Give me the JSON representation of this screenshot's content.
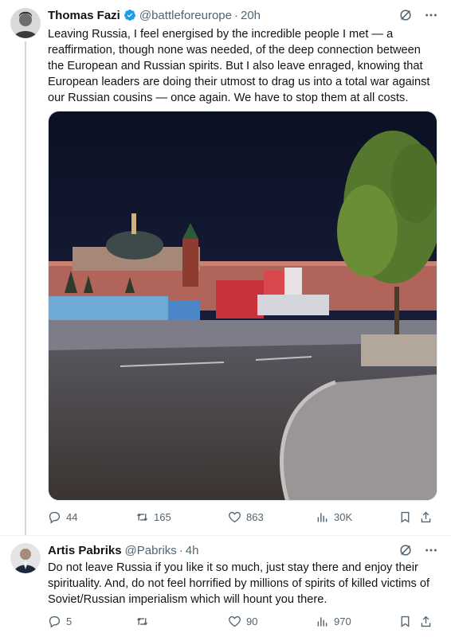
{
  "tweet1": {
    "author_name": "Thomas Fazi",
    "handle": "@battleforeurope",
    "separator": "·",
    "time": "20h",
    "verified_color": "#1d9bf0",
    "text": "Leaving Russia, I feel energised by the incredible people I met — a reaffirmation, though none was needed, of the deep connection between the European and Russian spirits. But I also leave enraged, knowing that European leaders are doing their utmost to drag us into a total war against our Russian cousins — once again. We have to stop them at all costs.",
    "image_alt_icons": [
      "kremlin-wall",
      "trees",
      "street-lamp"
    ],
    "replies": "44",
    "reposts": "165",
    "likes": "863",
    "views": "30K"
  },
  "tweet2": {
    "author_name": "Artis Pabriks",
    "handle": "@Pabriks",
    "separator": "·",
    "time": "4h",
    "text": "Do not leave Russia if you like it so much, just stay there and enjoy their spirituality. And, do not feel horrified by millions of spirits of killed victims of Soviet/Russian imperialism which will hount you there.",
    "replies": "5",
    "reposts": "",
    "likes": "90",
    "views": "970"
  },
  "colors": {
    "text_primary": "#0f1419",
    "text_secondary": "#536471",
    "accent": "#1d9bf0",
    "divider": "#eff3f4"
  }
}
